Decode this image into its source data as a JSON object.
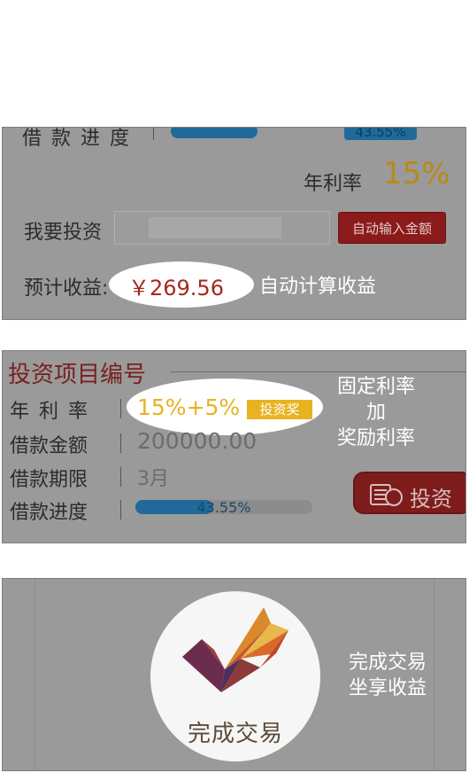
{
  "panel1": {
    "progress_label": "借 款 进 度",
    "progress_pct": "43.55%",
    "progress_value": 0.4355,
    "rate_label": "年利率",
    "rate_value": "15%",
    "invest_label": "我要投资",
    "autofill_button": "自动输入金额",
    "expected_label": "预计收益:",
    "expected_value": "￥269.56",
    "annotation": "自动计算收益"
  },
  "panel2": {
    "title": "投资项目编号",
    "rows": [
      {
        "label": "年 利 率",
        "value": "15%+5%"
      },
      {
        "label": "借款金额",
        "value": "200000.00"
      },
      {
        "label": "借款期限",
        "value": "3月"
      },
      {
        "label": "借款进度",
        "value": "43.55%"
      }
    ],
    "bonus_badge": "投资奖",
    "progress_value": 0.4355,
    "annotation_lines": [
      "固定利率",
      "加",
      "奖励利率"
    ],
    "invest_button": "投资"
  },
  "panel3": {
    "logo_text": "完成交易",
    "annotation_lines": [
      "完成交易",
      "坐享收益"
    ]
  },
  "colors": {
    "overlay_gray": "#9a9a9a",
    "accent_red": "#8b1a1a",
    "gold": "#c59415",
    "badge_yellow": "#e7b321",
    "progress_blue": "#1f6a9a"
  }
}
